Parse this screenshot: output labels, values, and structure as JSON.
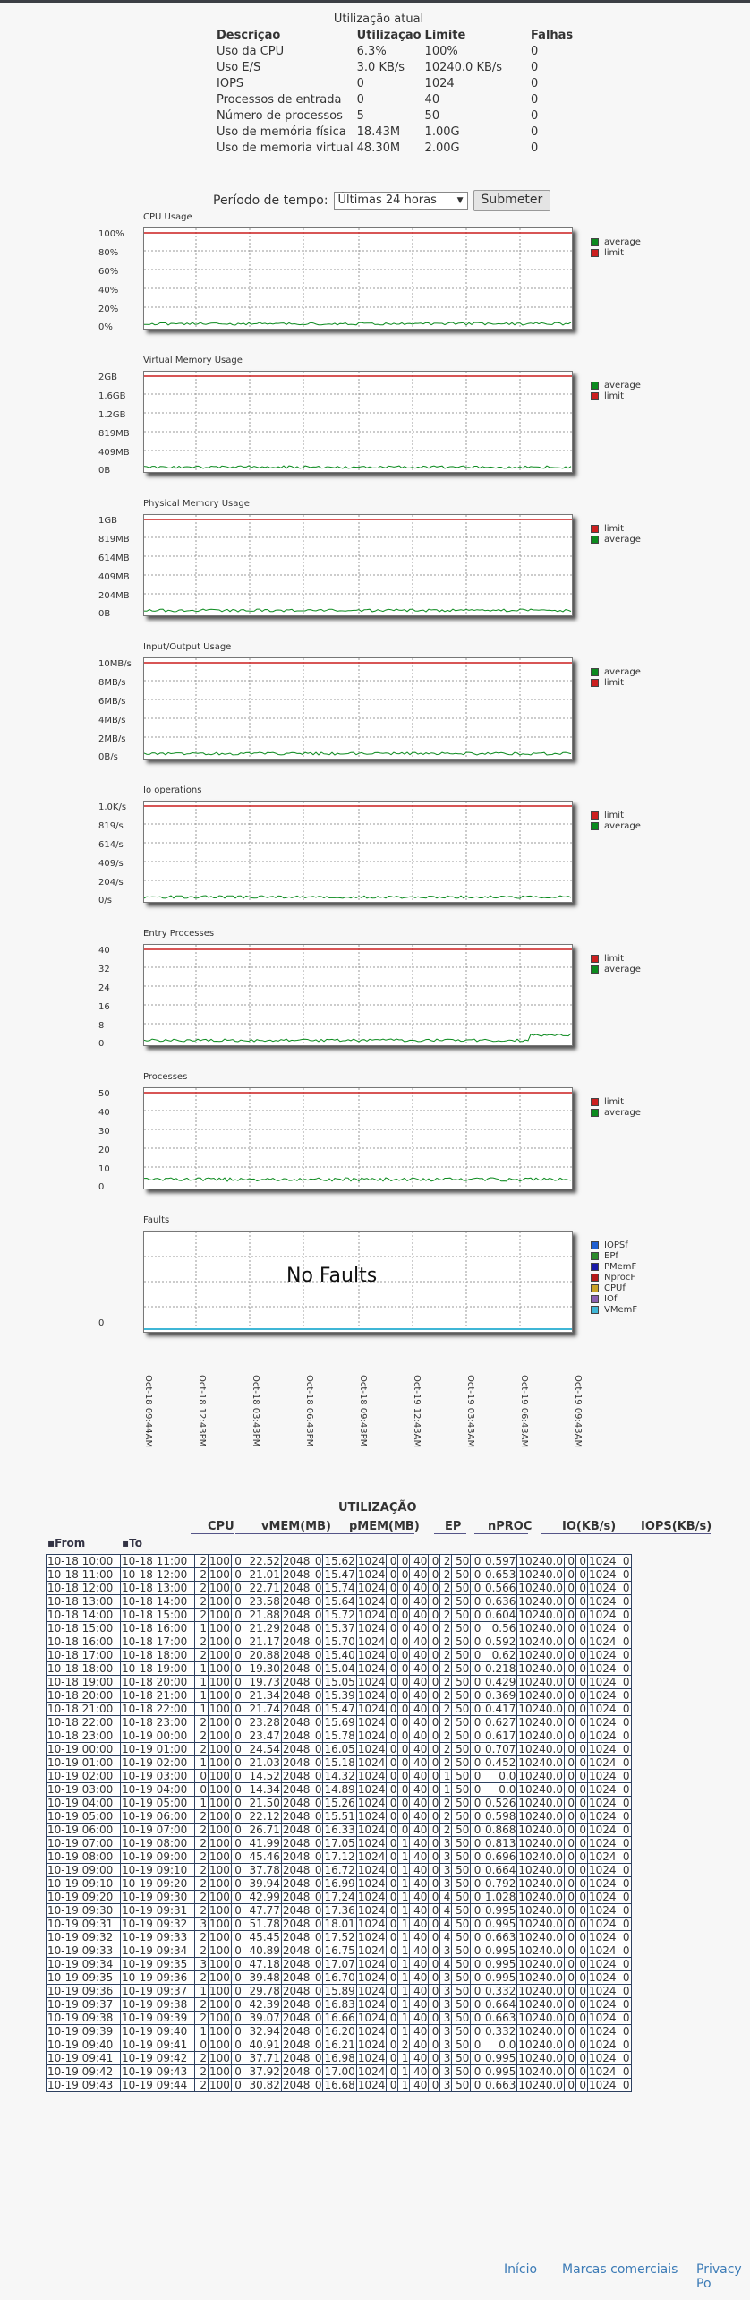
{
  "usage": {
    "title": "Utilização atual",
    "headers": [
      "Descrição",
      "Utilização",
      "Limite",
      "Falhas"
    ],
    "rows": [
      [
        "Uso da CPU",
        "6.3%",
        "100%",
        "0"
      ],
      [
        "Uso E/S",
        "3.0 KB/s",
        "10240.0 KB/s",
        "0"
      ],
      [
        "IOPS",
        "0",
        "1024",
        "0"
      ],
      [
        "Processos de entrada",
        "0",
        "40",
        "0"
      ],
      [
        "Número de processos",
        "5",
        "50",
        "0"
      ],
      [
        "Uso de memória física",
        "18.43M",
        "1.00G",
        "0"
      ],
      [
        "Uso de memoria virtual",
        "48.30M",
        "2.00G",
        "0"
      ]
    ]
  },
  "period": {
    "label": "Período de tempo:",
    "selected": "Últimas 24 horas",
    "submit": "Submeter"
  },
  "colors": {
    "average": "#0b8a1e",
    "limit": "#cc1f1f"
  },
  "charts": [
    {
      "title": "CPU Usage",
      "yticks": [
        "100%",
        "80%",
        "60%",
        "40%",
        "20%",
        "0%"
      ],
      "legend": [
        "average",
        "limit"
      ]
    },
    {
      "title": "Virtual Memory Usage",
      "yticks": [
        "2GB",
        "1.6GB",
        "1.2GB",
        "819MB",
        "409MB",
        "0B"
      ],
      "legend": [
        "average",
        "limit"
      ]
    },
    {
      "title": "Physical Memory Usage",
      "yticks": [
        "1GB",
        "819MB",
        "614MB",
        "409MB",
        "204MB",
        "0B"
      ],
      "legend": [
        "limit",
        "average"
      ]
    },
    {
      "title": "Input/Output Usage",
      "yticks": [
        "10MB/s",
        "8MB/s",
        "6MB/s",
        "4MB/s",
        "2MB/s",
        "0B/s"
      ],
      "legend": [
        "average",
        "limit"
      ]
    },
    {
      "title": "Io operations",
      "yticks": [
        "1.0K/s",
        "819/s",
        "614/s",
        "409/s",
        "204/s",
        "0/s"
      ],
      "legend": [
        "limit",
        "average"
      ]
    },
    {
      "title": "Entry Processes",
      "yticks": [
        "40",
        "32",
        "24",
        "16",
        "8",
        "0"
      ],
      "legend": [
        "limit",
        "average"
      ]
    },
    {
      "title": "Processes",
      "yticks": [
        "50",
        "40",
        "30",
        "20",
        "10",
        "0"
      ],
      "legend": [
        "limit",
        "average"
      ]
    }
  ],
  "faults": {
    "title": "Faults",
    "no_faults": "No Faults",
    "ytick": "0",
    "legend": [
      {
        "name": "IOPSf",
        "color": "#1f5fd1"
      },
      {
        "name": "EPf",
        "color": "#2b8a2b"
      },
      {
        "name": "PMemF",
        "color": "#1a1aa8"
      },
      {
        "name": "NprocF",
        "color": "#b51a1a"
      },
      {
        "name": "CPUf",
        "color": "#c9a227"
      },
      {
        "name": "IOf",
        "color": "#8a5fb0"
      },
      {
        "name": "VMemF",
        "color": "#3fb6d6"
      }
    ]
  },
  "xaxis": [
    "Oct-18 09:44AM",
    "Oct-18 12:43PM",
    "Oct-18 03:43PM",
    "Oct-18 06:43PM",
    "Oct-18 09:43PM",
    "Oct-19 12:43AM",
    "Oct-19 03:43AM",
    "Oct-19 06:43AM",
    "Oct-19 09:43AM"
  ],
  "table": {
    "title": "UTILIZAÇÃO",
    "groups": [
      "CPU",
      "vMEM(MB)",
      "pMEM(MB)",
      "EP",
      "nPROC",
      "IO(KB/s)",
      "IOPS(KB/s)"
    ],
    "from_label": "From",
    "to_label": "To",
    "rows": [
      [
        "10-18 10:00",
        "10-18 11:00",
        "2",
        "100",
        "0",
        "22.52",
        "2048",
        "0",
        "15.62",
        "1024",
        "0",
        "0",
        "40",
        "0",
        "2",
        "50",
        "0",
        "0.597",
        "10240.0",
        "0",
        "0",
        "1024",
        "0"
      ],
      [
        "10-18 11:00",
        "10-18 12:00",
        "2",
        "100",
        "0",
        "21.01",
        "2048",
        "0",
        "15.47",
        "1024",
        "0",
        "0",
        "40",
        "0",
        "2",
        "50",
        "0",
        "0.653",
        "10240.0",
        "0",
        "0",
        "1024",
        "0"
      ],
      [
        "10-18 12:00",
        "10-18 13:00",
        "2",
        "100",
        "0",
        "22.71",
        "2048",
        "0",
        "15.74",
        "1024",
        "0",
        "0",
        "40",
        "0",
        "2",
        "50",
        "0",
        "0.566",
        "10240.0",
        "0",
        "0",
        "1024",
        "0"
      ],
      [
        "10-18 13:00",
        "10-18 14:00",
        "2",
        "100",
        "0",
        "23.58",
        "2048",
        "0",
        "15.64",
        "1024",
        "0",
        "0",
        "40",
        "0",
        "2",
        "50",
        "0",
        "0.636",
        "10240.0",
        "0",
        "0",
        "1024",
        "0"
      ],
      [
        "10-18 14:00",
        "10-18 15:00",
        "2",
        "100",
        "0",
        "21.88",
        "2048",
        "0",
        "15.72",
        "1024",
        "0",
        "0",
        "40",
        "0",
        "2",
        "50",
        "0",
        "0.604",
        "10240.0",
        "0",
        "0",
        "1024",
        "0"
      ],
      [
        "10-18 15:00",
        "10-18 16:00",
        "1",
        "100",
        "0",
        "21.29",
        "2048",
        "0",
        "15.37",
        "1024",
        "0",
        "0",
        "40",
        "0",
        "2",
        "50",
        "0",
        "0.56",
        "10240.0",
        "0",
        "0",
        "1024",
        "0"
      ],
      [
        "10-18 16:00",
        "10-18 17:00",
        "2",
        "100",
        "0",
        "21.17",
        "2048",
        "0",
        "15.70",
        "1024",
        "0",
        "0",
        "40",
        "0",
        "2",
        "50",
        "0",
        "0.592",
        "10240.0",
        "0",
        "0",
        "1024",
        "0"
      ],
      [
        "10-18 17:00",
        "10-18 18:00",
        "2",
        "100",
        "0",
        "20.88",
        "2048",
        "0",
        "15.40",
        "1024",
        "0",
        "0",
        "40",
        "0",
        "2",
        "50",
        "0",
        "0.62",
        "10240.0",
        "0",
        "0",
        "1024",
        "0"
      ],
      [
        "10-18 18:00",
        "10-18 19:00",
        "1",
        "100",
        "0",
        "19.30",
        "2048",
        "0",
        "15.04",
        "1024",
        "0",
        "0",
        "40",
        "0",
        "2",
        "50",
        "0",
        "0.218",
        "10240.0",
        "0",
        "0",
        "1024",
        "0"
      ],
      [
        "10-18 19:00",
        "10-18 20:00",
        "1",
        "100",
        "0",
        "19.73",
        "2048",
        "0",
        "15.05",
        "1024",
        "0",
        "0",
        "40",
        "0",
        "2",
        "50",
        "0",
        "0.429",
        "10240.0",
        "0",
        "0",
        "1024",
        "0"
      ],
      [
        "10-18 20:00",
        "10-18 21:00",
        "1",
        "100",
        "0",
        "21.34",
        "2048",
        "0",
        "15.39",
        "1024",
        "0",
        "0",
        "40",
        "0",
        "2",
        "50",
        "0",
        "0.369",
        "10240.0",
        "0",
        "0",
        "1024",
        "0"
      ],
      [
        "10-18 21:00",
        "10-18 22:00",
        "1",
        "100",
        "0",
        "21.74",
        "2048",
        "0",
        "15.47",
        "1024",
        "0",
        "0",
        "40",
        "0",
        "2",
        "50",
        "0",
        "0.417",
        "10240.0",
        "0",
        "0",
        "1024",
        "0"
      ],
      [
        "10-18 22:00",
        "10-18 23:00",
        "2",
        "100",
        "0",
        "23.28",
        "2048",
        "0",
        "15.69",
        "1024",
        "0",
        "0",
        "40",
        "0",
        "2",
        "50",
        "0",
        "0.627",
        "10240.0",
        "0",
        "0",
        "1024",
        "0"
      ],
      [
        "10-18 23:00",
        "10-19 00:00",
        "2",
        "100",
        "0",
        "23.47",
        "2048",
        "0",
        "15.78",
        "1024",
        "0",
        "0",
        "40",
        "0",
        "2",
        "50",
        "0",
        "0.617",
        "10240.0",
        "0",
        "0",
        "1024",
        "0"
      ],
      [
        "10-19 00:00",
        "10-19 01:00",
        "2",
        "100",
        "0",
        "24.54",
        "2048",
        "0",
        "16.05",
        "1024",
        "0",
        "0",
        "40",
        "0",
        "2",
        "50",
        "0",
        "0.707",
        "10240.0",
        "0",
        "0",
        "1024",
        "0"
      ],
      [
        "10-19 01:00",
        "10-19 02:00",
        "1",
        "100",
        "0",
        "21.03",
        "2048",
        "0",
        "15.18",
        "1024",
        "0",
        "0",
        "40",
        "0",
        "2",
        "50",
        "0",
        "0.452",
        "10240.0",
        "0",
        "0",
        "1024",
        "0"
      ],
      [
        "10-19 02:00",
        "10-19 03:00",
        "0",
        "100",
        "0",
        "14.52",
        "2048",
        "0",
        "14.32",
        "1024",
        "0",
        "0",
        "40",
        "0",
        "1",
        "50",
        "0",
        "0.0",
        "10240.0",
        "0",
        "0",
        "1024",
        "0"
      ],
      [
        "10-19 03:00",
        "10-19 04:00",
        "0",
        "100",
        "0",
        "14.34",
        "2048",
        "0",
        "14.89",
        "1024",
        "0",
        "0",
        "40",
        "0",
        "1",
        "50",
        "0",
        "0.0",
        "10240.0",
        "0",
        "0",
        "1024",
        "0"
      ],
      [
        "10-19 04:00",
        "10-19 05:00",
        "1",
        "100",
        "0",
        "21.50",
        "2048",
        "0",
        "15.26",
        "1024",
        "0",
        "0",
        "40",
        "0",
        "2",
        "50",
        "0",
        "0.526",
        "10240.0",
        "0",
        "0",
        "1024",
        "0"
      ],
      [
        "10-19 05:00",
        "10-19 06:00",
        "2",
        "100",
        "0",
        "22.12",
        "2048",
        "0",
        "15.51",
        "1024",
        "0",
        "0",
        "40",
        "0",
        "2",
        "50",
        "0",
        "0.598",
        "10240.0",
        "0",
        "0",
        "1024",
        "0"
      ],
      [
        "10-19 06:00",
        "10-19 07:00",
        "2",
        "100",
        "0",
        "26.71",
        "2048",
        "0",
        "16.33",
        "1024",
        "0",
        "0",
        "40",
        "0",
        "2",
        "50",
        "0",
        "0.868",
        "10240.0",
        "0",
        "0",
        "1024",
        "0"
      ],
      [
        "10-19 07:00",
        "10-19 08:00",
        "2",
        "100",
        "0",
        "41.99",
        "2048",
        "0",
        "17.05",
        "1024",
        "0",
        "1",
        "40",
        "0",
        "3",
        "50",
        "0",
        "0.813",
        "10240.0",
        "0",
        "0",
        "1024",
        "0"
      ],
      [
        "10-19 08:00",
        "10-19 09:00",
        "2",
        "100",
        "0",
        "45.46",
        "2048",
        "0",
        "17.12",
        "1024",
        "0",
        "1",
        "40",
        "0",
        "3",
        "50",
        "0",
        "0.696",
        "10240.0",
        "0",
        "0",
        "1024",
        "0"
      ],
      [
        "10-19 09:00",
        "10-19 09:10",
        "2",
        "100",
        "0",
        "37.78",
        "2048",
        "0",
        "16.72",
        "1024",
        "0",
        "1",
        "40",
        "0",
        "3",
        "50",
        "0",
        "0.664",
        "10240.0",
        "0",
        "0",
        "1024",
        "0"
      ],
      [
        "10-19 09:10",
        "10-19 09:20",
        "2",
        "100",
        "0",
        "39.94",
        "2048",
        "0",
        "16.99",
        "1024",
        "0",
        "1",
        "40",
        "0",
        "3",
        "50",
        "0",
        "0.792",
        "10240.0",
        "0",
        "0",
        "1024",
        "0"
      ],
      [
        "10-19 09:20",
        "10-19 09:30",
        "2",
        "100",
        "0",
        "42.99",
        "2048",
        "0",
        "17.24",
        "1024",
        "0",
        "1",
        "40",
        "0",
        "4",
        "50",
        "0",
        "1.028",
        "10240.0",
        "0",
        "0",
        "1024",
        "0"
      ],
      [
        "10-19 09:30",
        "10-19 09:31",
        "2",
        "100",
        "0",
        "47.77",
        "2048",
        "0",
        "17.36",
        "1024",
        "0",
        "1",
        "40",
        "0",
        "4",
        "50",
        "0",
        "0.995",
        "10240.0",
        "0",
        "0",
        "1024",
        "0"
      ],
      [
        "10-19 09:31",
        "10-19 09:32",
        "3",
        "100",
        "0",
        "51.78",
        "2048",
        "0",
        "18.01",
        "1024",
        "0",
        "1",
        "40",
        "0",
        "4",
        "50",
        "0",
        "0.995",
        "10240.0",
        "0",
        "0",
        "1024",
        "0"
      ],
      [
        "10-19 09:32",
        "10-19 09:33",
        "2",
        "100",
        "0",
        "45.45",
        "2048",
        "0",
        "17.52",
        "1024",
        "0",
        "1",
        "40",
        "0",
        "4",
        "50",
        "0",
        "0.663",
        "10240.0",
        "0",
        "0",
        "1024",
        "0"
      ],
      [
        "10-19 09:33",
        "10-19 09:34",
        "2",
        "100",
        "0",
        "40.89",
        "2048",
        "0",
        "16.75",
        "1024",
        "0",
        "1",
        "40",
        "0",
        "3",
        "50",
        "0",
        "0.995",
        "10240.0",
        "0",
        "0",
        "1024",
        "0"
      ],
      [
        "10-19 09:34",
        "10-19 09:35",
        "3",
        "100",
        "0",
        "47.18",
        "2048",
        "0",
        "17.07",
        "1024",
        "0",
        "1",
        "40",
        "0",
        "4",
        "50",
        "0",
        "0.995",
        "10240.0",
        "0",
        "0",
        "1024",
        "0"
      ],
      [
        "10-19 09:35",
        "10-19 09:36",
        "2",
        "100",
        "0",
        "39.48",
        "2048",
        "0",
        "16.70",
        "1024",
        "0",
        "1",
        "40",
        "0",
        "3",
        "50",
        "0",
        "0.995",
        "10240.0",
        "0",
        "0",
        "1024",
        "0"
      ],
      [
        "10-19 09:36",
        "10-19 09:37",
        "1",
        "100",
        "0",
        "29.78",
        "2048",
        "0",
        "15.89",
        "1024",
        "0",
        "1",
        "40",
        "0",
        "3",
        "50",
        "0",
        "0.332",
        "10240.0",
        "0",
        "0",
        "1024",
        "0"
      ],
      [
        "10-19 09:37",
        "10-19 09:38",
        "2",
        "100",
        "0",
        "42.39",
        "2048",
        "0",
        "16.83",
        "1024",
        "0",
        "1",
        "40",
        "0",
        "3",
        "50",
        "0",
        "0.664",
        "10240.0",
        "0",
        "0",
        "1024",
        "0"
      ],
      [
        "10-19 09:38",
        "10-19 09:39",
        "2",
        "100",
        "0",
        "39.07",
        "2048",
        "0",
        "16.66",
        "1024",
        "0",
        "1",
        "40",
        "0",
        "3",
        "50",
        "0",
        "0.663",
        "10240.0",
        "0",
        "0",
        "1024",
        "0"
      ],
      [
        "10-19 09:39",
        "10-19 09:40",
        "1",
        "100",
        "0",
        "32.94",
        "2048",
        "0",
        "16.20",
        "1024",
        "0",
        "1",
        "40",
        "0",
        "3",
        "50",
        "0",
        "0.332",
        "10240.0",
        "0",
        "0",
        "1024",
        "0"
      ],
      [
        "10-19 09:40",
        "10-19 09:41",
        "0",
        "100",
        "0",
        "40.91",
        "2048",
        "0",
        "16.21",
        "1024",
        "0",
        "2",
        "40",
        "0",
        "3",
        "50",
        "0",
        "0.0",
        "10240.0",
        "0",
        "0",
        "1024",
        "0"
      ],
      [
        "10-19 09:41",
        "10-19 09:42",
        "2",
        "100",
        "0",
        "37.71",
        "2048",
        "0",
        "16.98",
        "1024",
        "0",
        "1",
        "40",
        "0",
        "3",
        "50",
        "0",
        "0.995",
        "10240.0",
        "0",
        "0",
        "1024",
        "0"
      ],
      [
        "10-19 09:42",
        "10-19 09:43",
        "2",
        "100",
        "0",
        "37.92",
        "2048",
        "0",
        "17.00",
        "1024",
        "0",
        "1",
        "40",
        "0",
        "3",
        "50",
        "0",
        "0.995",
        "10240.0",
        "0",
        "0",
        "1024",
        "0"
      ],
      [
        "10-19 09:43",
        "10-19 09:44",
        "2",
        "100",
        "0",
        "30.82",
        "2048",
        "0",
        "16.68",
        "1024",
        "0",
        "1",
        "40",
        "0",
        "3",
        "50",
        "0",
        "0.663",
        "10240.0",
        "0",
        "0",
        "1024",
        "0"
      ]
    ]
  },
  "footer": [
    "Início",
    "Marcas comerciais",
    "Privacy Po"
  ]
}
